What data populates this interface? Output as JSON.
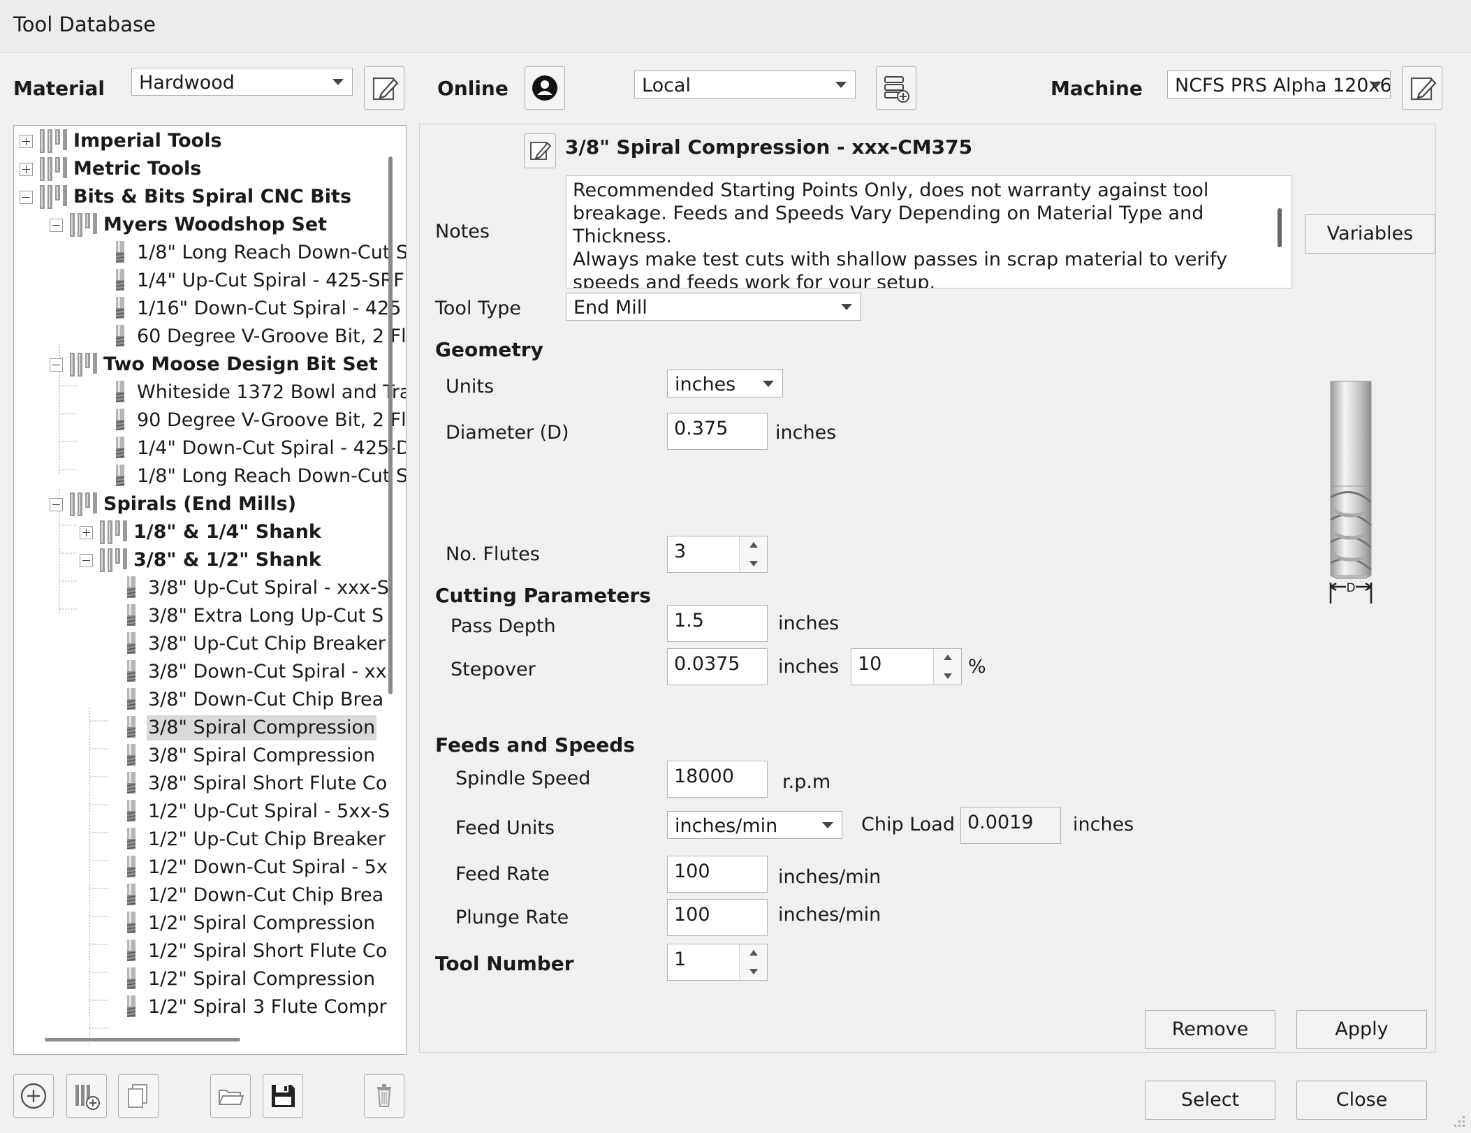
{
  "window": {
    "title": "Tool Database"
  },
  "top": {
    "material_label": "Material",
    "material_value": "Hardwood",
    "online_label": "Online",
    "online_value": "Local",
    "machine_label": "Machine",
    "machine_value": "NCFS PRS Alpha 120x6"
  },
  "tree": {
    "items": [
      {
        "label": "Imperial Tools",
        "type": "group",
        "expander": "plus"
      },
      {
        "label": "Metric Tools",
        "type": "group",
        "expander": "plus"
      },
      {
        "label": "Bits & Bits Spiral CNC Bits",
        "type": "group",
        "expander": "minus"
      },
      {
        "label": "Myers Woodshop Set",
        "type": "group",
        "expander": "minus"
      },
      {
        "label": "1/8\" Long Reach Down-Cut S",
        "type": "tool"
      },
      {
        "label": "1/4\" Up-Cut Spiral - 425-SRF",
        "type": "tool"
      },
      {
        "label": "1/16\" Down-Cut Spiral - 425",
        "type": "tool"
      },
      {
        "label": "60 Degree V-Groove Bit, 2 Fl",
        "type": "tool"
      },
      {
        "label": "Two Moose Design Bit Set",
        "type": "group",
        "expander": "minus"
      },
      {
        "label": "Whiteside 1372 Bowl and Tra",
        "type": "tool"
      },
      {
        "label": "90 Degree V-Groove Bit, 2 Fl",
        "type": "tool"
      },
      {
        "label": "1/4\" Down-Cut Spiral - 425-D",
        "type": "tool"
      },
      {
        "label": "1/8\" Long Reach Down-Cut S",
        "type": "tool"
      },
      {
        "label": "Spirals (End Mills)",
        "type": "group",
        "expander": "minus"
      },
      {
        "label": "1/8\" & 1/4\" Shank",
        "type": "group",
        "expander": "plus"
      },
      {
        "label": "3/8\" & 1/2\" Shank",
        "type": "group",
        "expander": "minus"
      },
      {
        "label": "3/8\" Up-Cut Spiral - xxx-S",
        "type": "tool"
      },
      {
        "label": "3/8\" Extra Long Up-Cut S",
        "type": "tool"
      },
      {
        "label": "3/8\" Up-Cut Chip Breaker",
        "type": "tool"
      },
      {
        "label": "3/8\" Down-Cut Spiral - xx",
        "type": "tool"
      },
      {
        "label": "3/8\" Down-Cut Chip Brea",
        "type": "tool"
      },
      {
        "label": "3/8\" Spiral Compression",
        "type": "tool",
        "selected": true
      },
      {
        "label": "3/8\" Spiral Compression",
        "type": "tool"
      },
      {
        "label": "3/8\" Spiral Short Flute Co",
        "type": "tool"
      },
      {
        "label": "1/2\" Up-Cut Spiral - 5xx-S",
        "type": "tool"
      },
      {
        "label": "1/2\" Up-Cut Chip Breaker",
        "type": "tool"
      },
      {
        "label": "1/2\" Down-Cut Spiral - 5x",
        "type": "tool"
      },
      {
        "label": "1/2\" Down-Cut Chip Brea",
        "type": "tool"
      },
      {
        "label": "1/2\" Spiral Compression",
        "type": "tool"
      },
      {
        "label": "1/2\" Spiral Short Flute Co",
        "type": "tool"
      },
      {
        "label": "1/2\" Spiral Compression",
        "type": "tool"
      },
      {
        "label": "1/2\" Spiral 3 Flute Compr",
        "type": "tool"
      }
    ]
  },
  "tool": {
    "name": "3/8\" Spiral Compression - xxx-CM375",
    "notes_label": "Notes",
    "notes": "Recommended Starting Points Only, does not warranty against tool breakage. Feeds and Speeds Vary Depending on Material Type and Thickness.\nAlways make test cuts with shallow passes in scrap material to verify speeds and feeds work for your setup.\nUse Caution and Proper Safety Equipment When Using Cutting Tools",
    "variables_label": "Variables",
    "tool_type_label": "Tool Type",
    "tool_type": "End Mill"
  },
  "geometry": {
    "heading": "Geometry",
    "units_label": "Units",
    "units": "inches",
    "diameter_label": "Diameter (D)",
    "diameter": "0.375",
    "diameter_unit": "inches",
    "flutes_label": "No. Flutes",
    "flutes": "3",
    "diagram_label": "D"
  },
  "cutting": {
    "heading": "Cutting Parameters",
    "pass_depth_label": "Pass Depth",
    "pass_depth": "1.5",
    "pass_depth_unit": "inches",
    "stepover_label": "Stepover",
    "stepover": "0.0375",
    "stepover_unit": "inches",
    "stepover_pct": "10",
    "pct_symbol": "%"
  },
  "feeds": {
    "heading": "Feeds and Speeds",
    "spindle_label": "Spindle Speed",
    "spindle": "18000",
    "spindle_unit": "r.p.m",
    "feed_units_label": "Feed Units",
    "feed_units": "inches/min",
    "chip_load_label": "Chip Load",
    "chip_load": "0.0019",
    "chip_load_unit": "inches",
    "feed_rate_label": "Feed Rate",
    "feed_rate": "100",
    "feed_rate_unit": "inches/min",
    "plunge_label": "Plunge Rate",
    "plunge": "100",
    "plunge_unit": "inches/min"
  },
  "tool_number": {
    "label": "Tool Number",
    "value": "1"
  },
  "buttons": {
    "remove": "Remove",
    "apply": "Apply",
    "select": "Select",
    "close": "Close"
  },
  "toolbar_icons": [
    "add-tool-icon",
    "add-group-icon",
    "copy-icon",
    "open-folder-icon",
    "save-icon",
    "delete-icon"
  ]
}
